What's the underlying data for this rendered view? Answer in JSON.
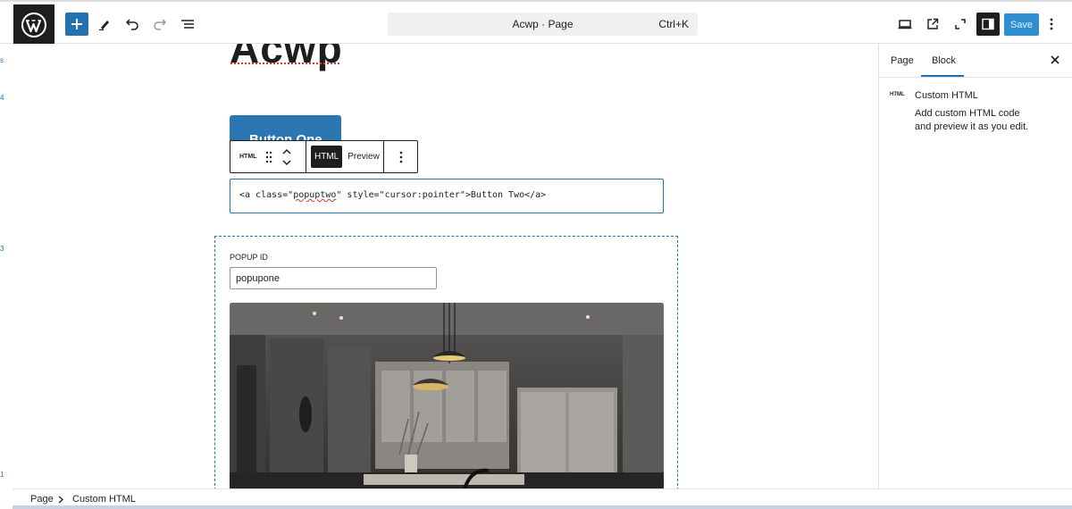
{
  "header": {
    "document_title": "Acwp · Page",
    "shortcut": "Ctrl+K",
    "save_label": "Save"
  },
  "gutter": {
    "marks": [
      "s",
      "4",
      "3",
      "1"
    ]
  },
  "editor": {
    "page_title": "Acwp",
    "button_one_label": "Button One",
    "block_toolbar": {
      "type_label": "HTML",
      "mode_html": "HTML",
      "mode_preview": "Preview"
    },
    "code": {
      "before": "<a class=\"",
      "squiggle": "popuptwo",
      "after": "\" style=\"cursor:pointer\">Button Two</a>"
    },
    "popup": {
      "label": "POPUP ID",
      "input_value": "popupone"
    }
  },
  "sidebar": {
    "tabs": [
      "Page",
      "Block"
    ],
    "active_tab": "Block",
    "block": {
      "icon_text": "HTML",
      "name": "Custom HTML",
      "description": "Add custom HTML code and preview it as you edit."
    }
  },
  "breadcrumb": {
    "items": [
      "Page",
      "Custom HTML"
    ]
  },
  "colors": {
    "accent": "#2271b1",
    "dark": "#1e1e1e"
  }
}
